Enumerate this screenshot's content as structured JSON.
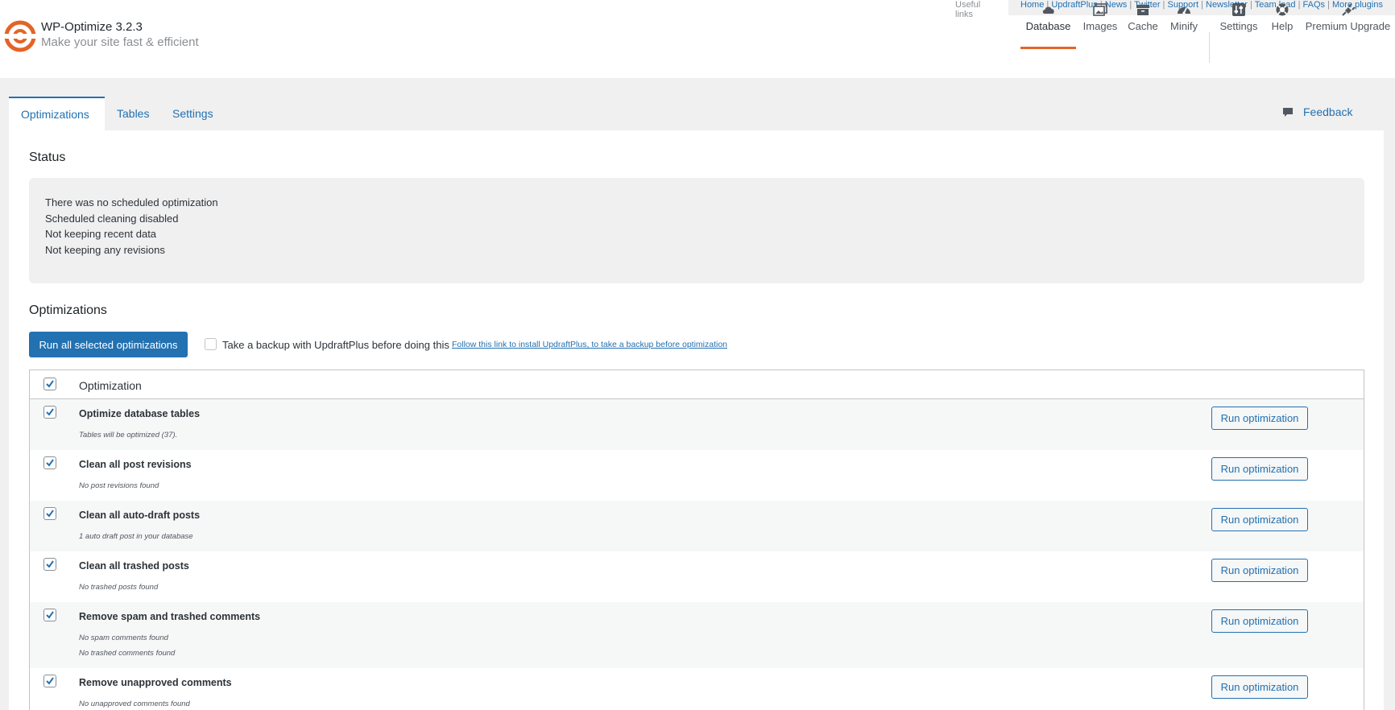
{
  "app": {
    "title": "WP-Optimize 3.2.3",
    "subtitle": "Make your site fast & efficient",
    "accent": "#e36426",
    "link_color": "#2271b1"
  },
  "useful_links": {
    "label": "Useful links",
    "links": [
      "Home",
      "UpdraftPlus",
      "News",
      "Twitter",
      "Support",
      "Newsletter",
      "Team lead",
      "FAQs",
      "More plugins"
    ]
  },
  "main_nav": [
    {
      "label": "Database",
      "icon": "cloud-icon",
      "active": true
    },
    {
      "label": "Images",
      "icon": "images-icon"
    },
    {
      "label": "Cache",
      "icon": "archive-icon"
    },
    {
      "label": "Minify",
      "icon": "dashboard-icon"
    },
    {
      "label": "Settings",
      "icon": "settings-icon"
    },
    {
      "label": "Help",
      "icon": "lifebuoy-icon"
    },
    {
      "label": "Premium Upgrade",
      "icon": "plug-icon"
    }
  ],
  "tabs": [
    "Optimizations",
    "Tables",
    "Settings"
  ],
  "feedback": {
    "label": "Feedback",
    "icon": "comment-icon"
  },
  "status": {
    "heading": "Status",
    "lines": [
      "There was no scheduled optimization",
      "Scheduled cleaning disabled",
      "Not keeping recent data",
      "Not keeping any revisions"
    ]
  },
  "optimizations": {
    "heading": "Optimizations",
    "run_all_label": "Run all selected optimizations",
    "backup_label": "Take a backup with UpdraftPlus before doing this",
    "backup_checked": false,
    "backup_link": "Follow this link to install UpdraftPlus, to take a backup before optimization",
    "column_header": "Optimization",
    "header_checked": true,
    "run_label": "Run optimization",
    "rows": [
      {
        "title": "Optimize database tables",
        "checked": true,
        "notes": [
          "Tables will be optimized (37)."
        ]
      },
      {
        "title": "Clean all post revisions",
        "checked": true,
        "notes": [
          "No post revisions found"
        ]
      },
      {
        "title": "Clean all auto-draft posts",
        "checked": true,
        "notes": [
          "1 auto draft post in your database"
        ]
      },
      {
        "title": "Clean all trashed posts",
        "checked": true,
        "notes": [
          "No trashed posts found"
        ]
      },
      {
        "title": "Remove spam and trashed comments",
        "checked": true,
        "notes": [
          "No spam comments found",
          "No trashed comments found"
        ]
      },
      {
        "title": "Remove unapproved comments",
        "checked": true,
        "notes": [
          "No unapproved comments found"
        ]
      }
    ]
  }
}
